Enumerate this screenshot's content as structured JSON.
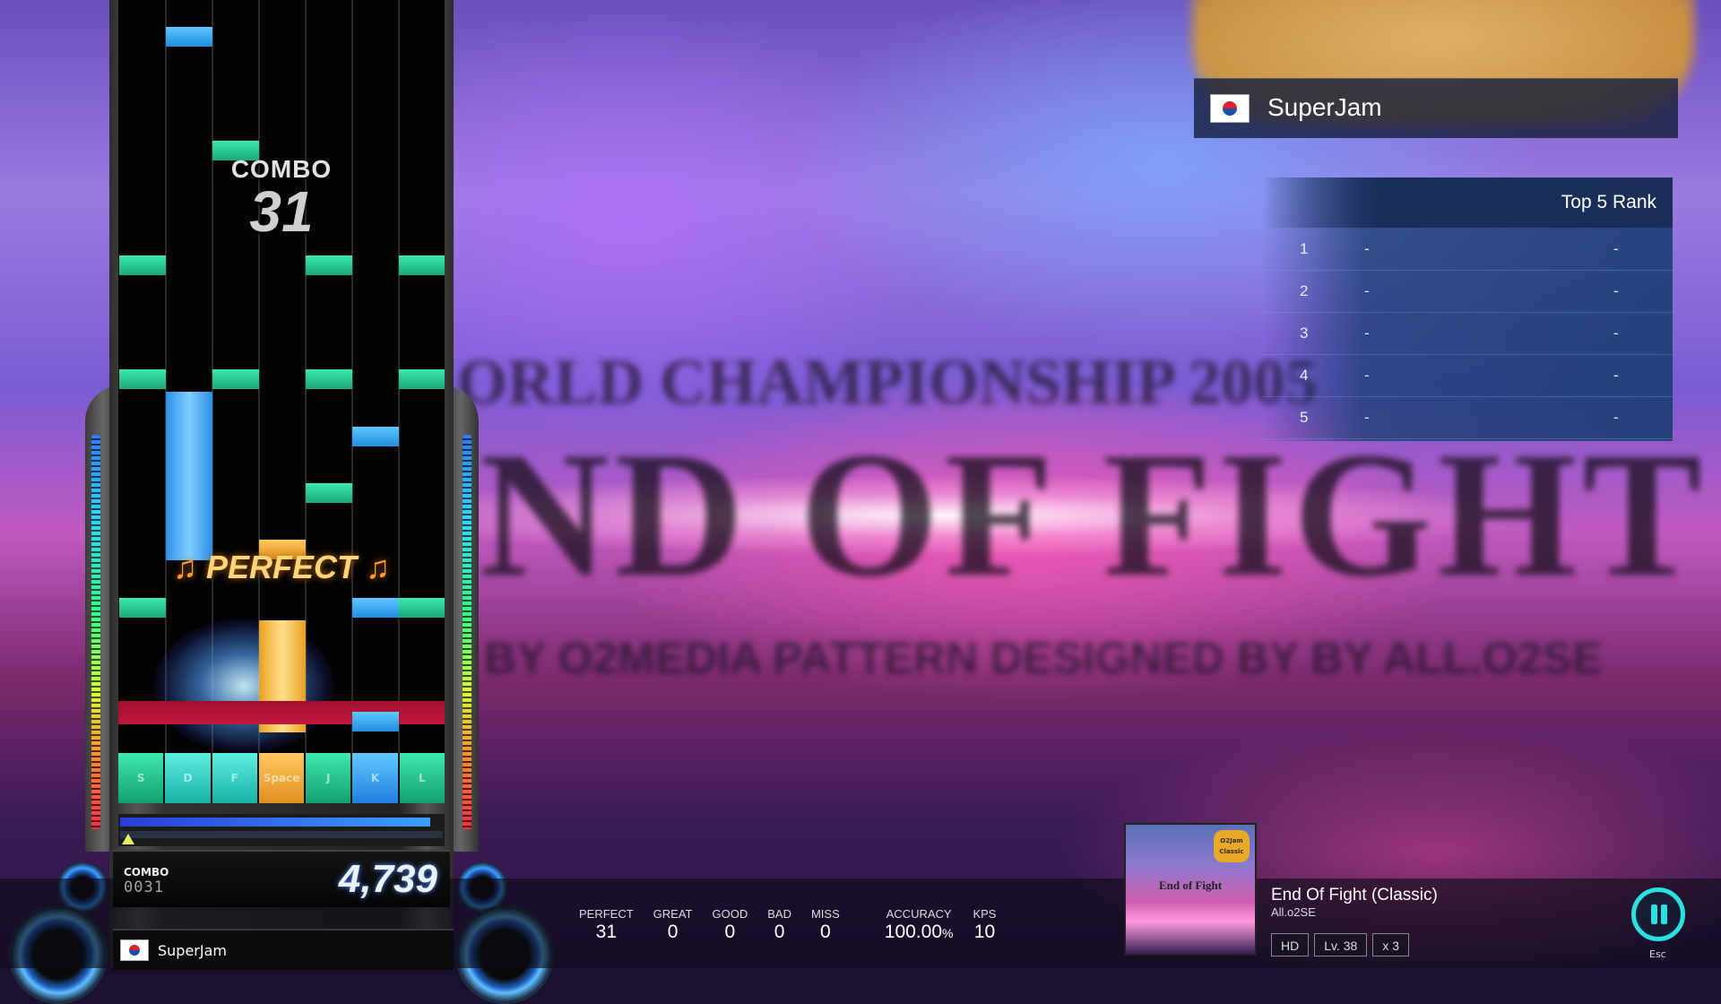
{
  "background": {
    "line1": "ORLD CHAMPIONSHIP 2005",
    "line2": "ND OF FIGHT",
    "line3": "BY O2MEDIA PATTERN DESIGNED BY BY ALL.O2SE"
  },
  "playfield": {
    "combo_label": "COMBO",
    "combo_value": "31",
    "judgement": "PERFECT",
    "keys": [
      "S",
      "D",
      "F",
      "Space",
      "J",
      "K",
      "L"
    ],
    "life_fraction": 0.96
  },
  "score_panel": {
    "combo_label": "COMBO",
    "combo_value": "0031",
    "score": "4,739"
  },
  "player": {
    "name": "SuperJam",
    "flag": "south-korea-flag"
  },
  "stats": [
    {
      "label": "PERFECT",
      "value": "31"
    },
    {
      "label": "GREAT",
      "value": "0"
    },
    {
      "label": "GOOD",
      "value": "0"
    },
    {
      "label": "BAD",
      "value": "0"
    },
    {
      "label": "MISS",
      "value": "0"
    }
  ],
  "accuracy": {
    "label": "ACCURACY",
    "value": "100.00",
    "unit": "%"
  },
  "kps": {
    "label": "KPS",
    "value": "10"
  },
  "song": {
    "title": "End Of Fight (Classic)",
    "artist": "All.o2SE",
    "difficulty": "HD",
    "level": "Lv. 38",
    "speed": "x 3",
    "album_badge": "O2Jam Classic",
    "album_text": "End of Fight"
  },
  "pause": {
    "key_hint": "Esc",
    "icon": "pause-icon"
  },
  "ranking": {
    "title": "Top 5 Rank",
    "rows": [
      {
        "pos": "1",
        "name": "-",
        "score": "-"
      },
      {
        "pos": "2",
        "name": "-",
        "score": "-"
      },
      {
        "pos": "3",
        "name": "-",
        "score": "-"
      },
      {
        "pos": "4",
        "name": "-",
        "score": "-"
      },
      {
        "pos": "5",
        "name": "-",
        "score": "-"
      }
    ]
  },
  "colors": {
    "white_note": "#3ee8b0",
    "blue_note": "#5fc6ff",
    "space_note": "#ffc860",
    "judge_line": "#c0163a",
    "pause_accent": "#2ae0e0"
  }
}
